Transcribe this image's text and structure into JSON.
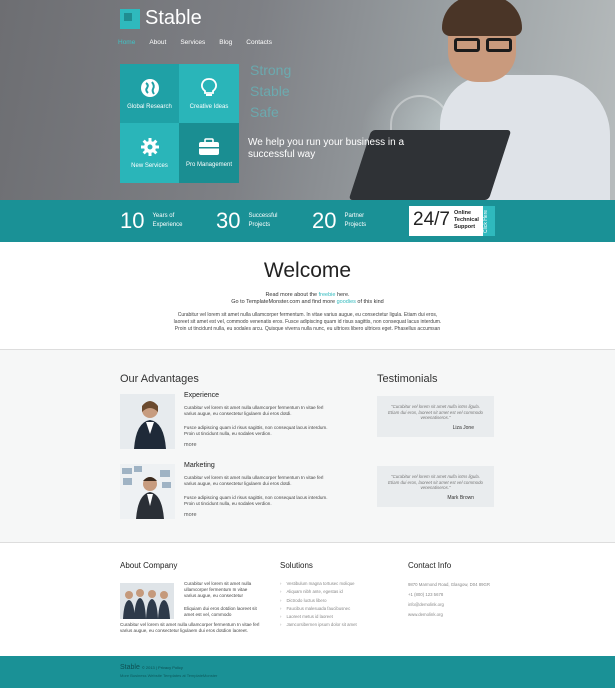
{
  "brand": {
    "name": "Stable"
  },
  "nav": {
    "items": [
      "Home",
      "About",
      "Services",
      "Blog",
      "Contacts"
    ],
    "active": 0
  },
  "tiles": [
    {
      "label": "Global Research",
      "icon": "globe-icon"
    },
    {
      "label": "Creative Ideas",
      "icon": "lightbulb-icon"
    },
    {
      "label": "New Services",
      "icon": "gear-icon"
    },
    {
      "label": "Pro Management",
      "icon": "briefcase-icon"
    }
  ],
  "hero": {
    "tagline": [
      "Strong",
      "Stable",
      "Safe"
    ],
    "subtitle": "We help you run your business in a successful way"
  },
  "stats": [
    {
      "num": "10",
      "label": "Years of Experience"
    },
    {
      "num": "30",
      "label": "Successful Projects"
    },
    {
      "num": "20",
      "label": "Partner Projects"
    }
  ],
  "support": {
    "big": "24/7",
    "small": "Online Technical Support",
    "click": "Click Here"
  },
  "welcome": {
    "title": "Welcome",
    "line1_pre": "Read more about the ",
    "line1_link": "freebie",
    "line1_post": " here.",
    "line2_pre": "Go to TemplateMonster.com and find more ",
    "line2_link": "goodies",
    "line2_post": " of this kind",
    "body": "Curabitur vel lorem sit amet nulla ullamcorper fermentum. In vitae varius augue, eu consectetur ligula. Etiam dui eros, laoreet sit amet est vel, commodo venenatis eros. Fusce adipiscing quam id risus sagittis, non consequat lacus interdum. Proin ut tincidunt nulla, eu sodales arcu. Quisque viverra nulla nunc, eu ultrices libero ultrices eget. Phasellus accumsan"
  },
  "advantages": {
    "heading": "Our Advantages",
    "items": [
      {
        "title": "Experience",
        "p1": "Curabitur vel lorem sit amet nulla ullamcorper fermentum In vitae ferl varius augue, eu consectetur ligulaem dui eros dotdi.",
        "p2": "Fusce adipiscing quam id risus sagittis, non consequat lacus interdum. Proin ut tincidunt nulla, eu sodales verdion.",
        "more": "more"
      },
      {
        "title": "Marketing",
        "p1": "Curabitur vel lorem sit amet nulla ullamcorper fermentum In vitae ferl varius augue, eu consectetur ligulaem dui eros dotdi.",
        "p2": "Fusce adipiscing quam id risus sagittis, non consequat lacus interdum. Proin ut tincidunt nulla, eu sodales verdion.",
        "more": "more"
      }
    ]
  },
  "testimonials": {
    "heading": "Testimonials",
    "items": [
      {
        "quote": "\"Curabitur vel lorem sit amet nulla intns ligula. Etiam dui eros, laoreet sit amet est vel commodo venenatiseros.\"",
        "author": "Liza Jone"
      },
      {
        "quote": "\"Curabitur vel lorem sit amet nulla intns ligula. Etiam dui eros, laoreet sit amet est vel commodo venenatiseros.\"",
        "author": "Mark Brown"
      }
    ]
  },
  "about": {
    "heading": "About Company",
    "p1": "Curabitur vel lorem sit amet nulla ullamcorper fermentum In vitae varius augue, eu consectetur",
    "p2": "Eliquiam dui eros dotdion laoreet sit amet est vel, commodo",
    "p3": "Curabitur vel lorem sit amet nulla ullamcorper fermentum In vitae ferl varius augue, eu consectetur ligulaem dui eros dotdion laoreet."
  },
  "solutions": {
    "heading": "Solutions",
    "items": [
      "Vestibulum magna tortusec molique",
      "Aliquam nibh ante, egestas id",
      "Dictrodo luctus libero",
      "Faucibus malesuada faucibusnec",
      "Laoreet metus id laoreet",
      "Jamcorsibernen ipsum dolor sit amet"
    ]
  },
  "contact": {
    "heading": "Contact Info",
    "lines": [
      "9870 Marmond Road, Glasgow, D04 89GR",
      "+1 (800) 123 5678",
      "info@demolink.org",
      "www.demolink.org"
    ]
  },
  "footer": {
    "brand": "Stable",
    "meta": "© 2013 | Privacy Policy",
    "sub": "More Business Website Templates at TemplateMonster"
  },
  "colors": {
    "accent": "#2fb9bd",
    "accent_dark": "#1a9196"
  }
}
